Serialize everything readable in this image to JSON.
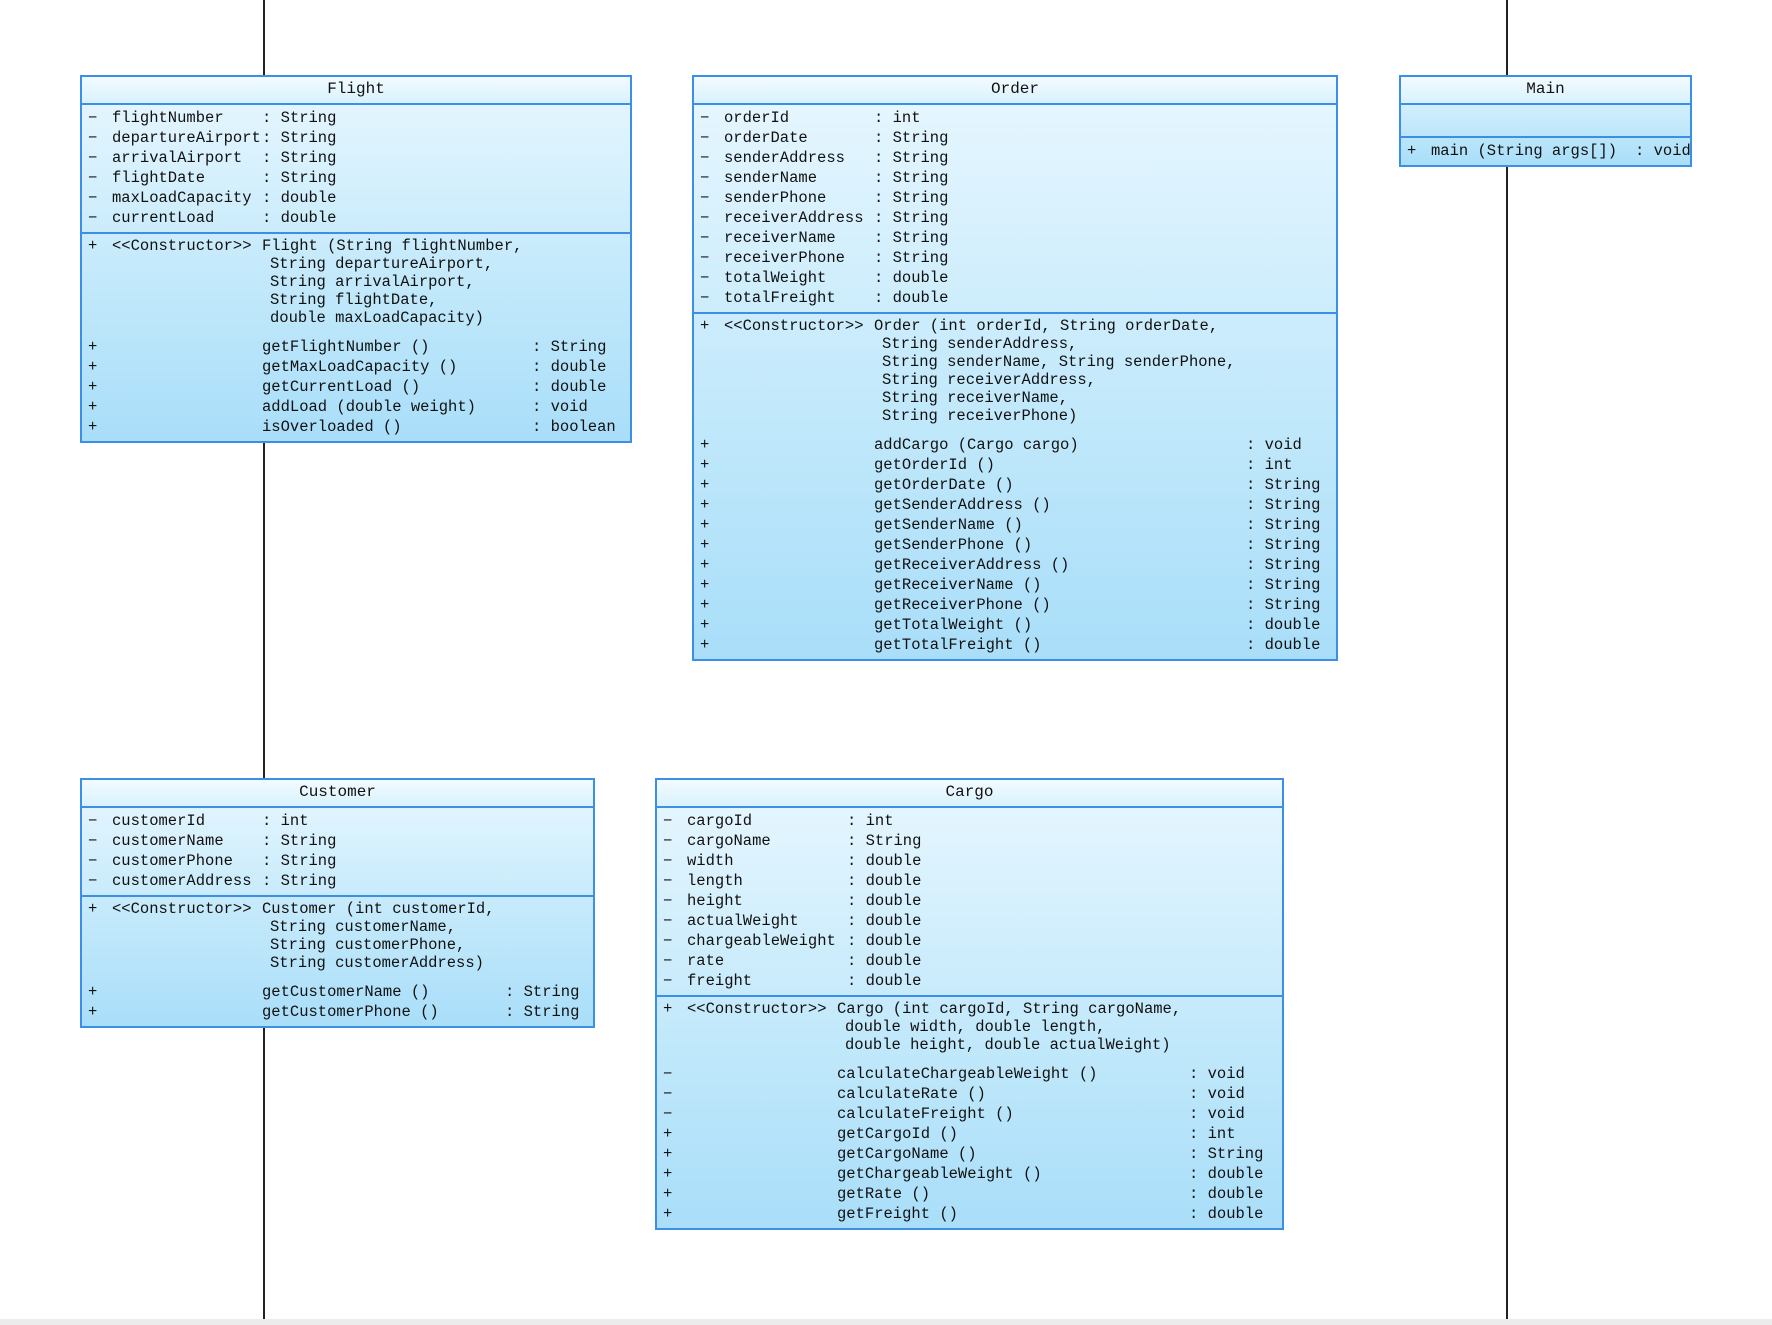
{
  "classes": {
    "flight": {
      "name": "Flight",
      "attributes": [
        {
          "vis": "−",
          "name": "flightNumber",
          "type": ": String"
        },
        {
          "vis": "−",
          "name": "departureAirport",
          "type": ": String"
        },
        {
          "vis": "−",
          "name": "arrivalAirport",
          "type": ": String"
        },
        {
          "vis": "−",
          "name": "flightDate",
          "type": ": String"
        },
        {
          "vis": "−",
          "name": "maxLoadCapacity",
          "type": ": double"
        },
        {
          "vis": "−",
          "name": "currentLoad",
          "type": ": double"
        }
      ],
      "constructor": {
        "vis": "+",
        "stereotype": "<<Constructor>>",
        "lines": [
          "Flight (String flightNumber,",
          "String departureAirport,",
          "String arrivalAirport,",
          "String flightDate,",
          "double maxLoadCapacity)"
        ]
      },
      "methods": [
        {
          "vis": "+",
          "name": "getFlightNumber ()",
          "type": ": String"
        },
        {
          "vis": "+",
          "name": "getMaxLoadCapacity ()",
          "type": ": double"
        },
        {
          "vis": "+",
          "name": "getCurrentLoad ()",
          "type": ": double"
        },
        {
          "vis": "+",
          "name": "addLoad (double weight)",
          "type": ": void"
        },
        {
          "vis": "+",
          "name": "isOverloaded ()",
          "type": ": boolean"
        }
      ]
    },
    "order": {
      "name": "Order",
      "attributes": [
        {
          "vis": "−",
          "name": "orderId",
          "type": ": int"
        },
        {
          "vis": "−",
          "name": "orderDate",
          "type": ": String"
        },
        {
          "vis": "−",
          "name": "senderAddress",
          "type": ": String"
        },
        {
          "vis": "−",
          "name": "senderName",
          "type": ": String"
        },
        {
          "vis": "−",
          "name": "senderPhone",
          "type": ": String"
        },
        {
          "vis": "−",
          "name": "receiverAddress",
          "type": ": String"
        },
        {
          "vis": "−",
          "name": "receiverName",
          "type": ": String"
        },
        {
          "vis": "−",
          "name": "receiverPhone",
          "type": ": String"
        },
        {
          "vis": "−",
          "name": "totalWeight",
          "type": ": double"
        },
        {
          "vis": "−",
          "name": "totalFreight",
          "type": ": double"
        }
      ],
      "constructor": {
        "vis": "+",
        "stereotype": "<<Constructor>>",
        "lines": [
          "Order (int orderId, String orderDate,",
          "String senderAddress,",
          "String senderName, String senderPhone,",
          "String receiverAddress,",
          "String receiverName,",
          "String receiverPhone)"
        ]
      },
      "methods": [
        {
          "vis": "+",
          "name": "addCargo (Cargo cargo)",
          "type": ": void"
        },
        {
          "vis": "+",
          "name": "getOrderId ()",
          "type": ": int"
        },
        {
          "vis": "+",
          "name": "getOrderDate ()",
          "type": ": String"
        },
        {
          "vis": "+",
          "name": "getSenderAddress ()",
          "type": ": String"
        },
        {
          "vis": "+",
          "name": "getSenderName ()",
          "type": ": String"
        },
        {
          "vis": "+",
          "name": "getSenderPhone ()",
          "type": ": String"
        },
        {
          "vis": "+",
          "name": "getReceiverAddress ()",
          "type": ": String"
        },
        {
          "vis": "+",
          "name": "getReceiverName ()",
          "type": ": String"
        },
        {
          "vis": "+",
          "name": "getReceiverPhone ()",
          "type": ": String"
        },
        {
          "vis": "+",
          "name": "getTotalWeight ()",
          "type": ": double"
        },
        {
          "vis": "+",
          "name": "getTotalFreight ()",
          "type": ": double"
        }
      ]
    },
    "main": {
      "name": "Main",
      "methods": [
        {
          "vis": "+",
          "name": "main (String args[])",
          "type": ": void"
        }
      ]
    },
    "customer": {
      "name": "Customer",
      "attributes": [
        {
          "vis": "−",
          "name": "customerId",
          "type": ": int"
        },
        {
          "vis": "−",
          "name": "customerName",
          "type": ": String"
        },
        {
          "vis": "−",
          "name": "customerPhone",
          "type": ": String"
        },
        {
          "vis": "−",
          "name": "customerAddress",
          "type": ": String"
        }
      ],
      "constructor": {
        "vis": "+",
        "stereotype": "<<Constructor>>",
        "lines": [
          "Customer (int customerId,",
          "String customerName,",
          "String customerPhone,",
          "String customerAddress)"
        ]
      },
      "methods": [
        {
          "vis": "+",
          "name": "getCustomerName ()",
          "type": ": String"
        },
        {
          "vis": "+",
          "name": "getCustomerPhone ()",
          "type": ": String"
        }
      ]
    },
    "cargo": {
      "name": "Cargo",
      "attributes": [
        {
          "vis": "−",
          "name": "cargoId",
          "type": ": int"
        },
        {
          "vis": "−",
          "name": "cargoName",
          "type": ": String"
        },
        {
          "vis": "−",
          "name": "width",
          "type": ": double"
        },
        {
          "vis": "−",
          "name": "length",
          "type": ": double"
        },
        {
          "vis": "−",
          "name": "height",
          "type": ": double"
        },
        {
          "vis": "−",
          "name": "actualWeight",
          "type": ": double"
        },
        {
          "vis": "−",
          "name": "chargeableWeight",
          "type": ": double"
        },
        {
          "vis": "−",
          "name": "rate",
          "type": ": double"
        },
        {
          "vis": "−",
          "name": "freight",
          "type": ": double"
        }
      ],
      "constructor": {
        "vis": "+",
        "stereotype": "<<Constructor>>",
        "lines": [
          "Cargo (int cargoId, String cargoName,",
          "double width, double length,",
          "double height, double actualWeight)"
        ]
      },
      "methods": [
        {
          "vis": "−",
          "name": "calculateChargeableWeight ()",
          "type": ": void"
        },
        {
          "vis": "−",
          "name": "calculateRate ()",
          "type": ": void"
        },
        {
          "vis": "−",
          "name": "calculateFreight ()",
          "type": ": void"
        },
        {
          "vis": "+",
          "name": "getCargoId ()",
          "type": ": int"
        },
        {
          "vis": "+",
          "name": "getCargoName ()",
          "type": ": String"
        },
        {
          "vis": "+",
          "name": "getChargeableWeight ()",
          "type": ": double"
        },
        {
          "vis": "+",
          "name": "getRate ()",
          "type": ": double"
        },
        {
          "vis": "+",
          "name": "getFreight ()",
          "type": ": double"
        }
      ]
    }
  }
}
